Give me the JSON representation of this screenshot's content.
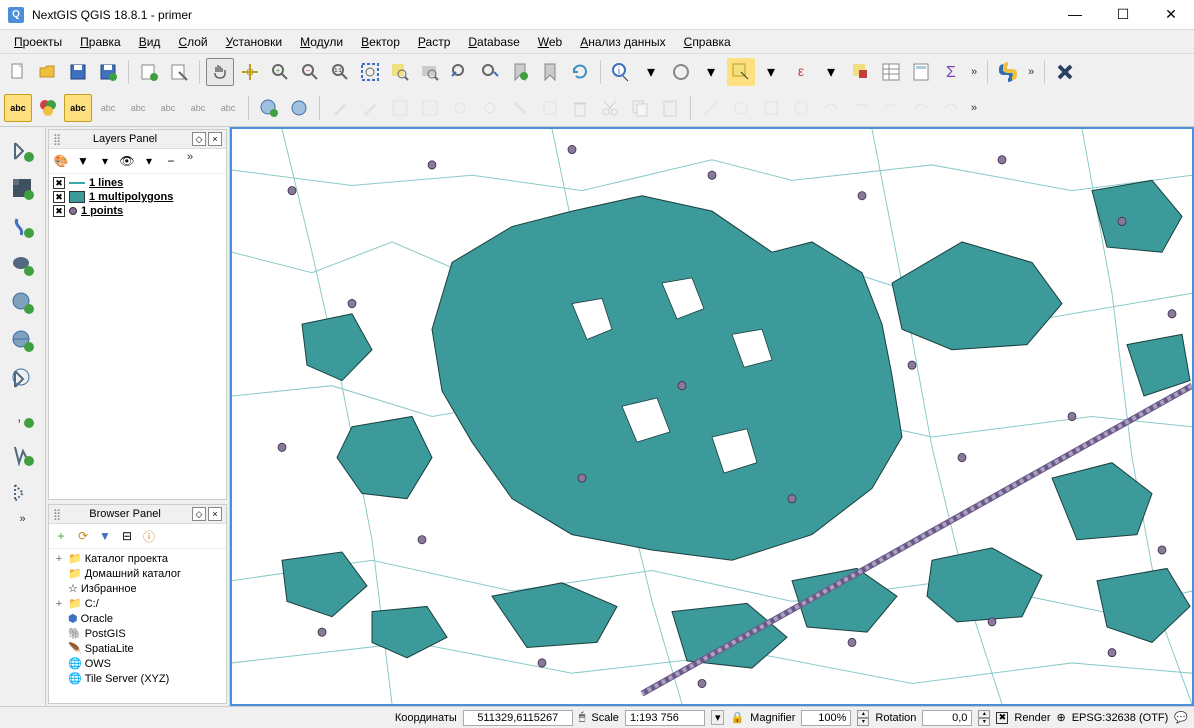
{
  "window": {
    "title": "NextGIS QGIS 18.8.1 - primer",
    "minimize": "—",
    "maximize": "☐",
    "close": "✕"
  },
  "menu": {
    "items": [
      {
        "label": "Проекты",
        "u": "П"
      },
      {
        "label": "Правка",
        "u": "П"
      },
      {
        "label": "Вид",
        "u": "В"
      },
      {
        "label": "Слой",
        "u": "С"
      },
      {
        "label": "Установки",
        "u": "У"
      },
      {
        "label": "Модули",
        "u": "М"
      },
      {
        "label": "Вектор",
        "u": "В"
      },
      {
        "label": "Растр",
        "u": "Р"
      },
      {
        "label": "Database",
        "u": "D"
      },
      {
        "label": "Web",
        "u": "W"
      },
      {
        "label": "Анализ данных",
        "u": "А"
      },
      {
        "label": "Справка",
        "u": "С"
      }
    ]
  },
  "layers_panel": {
    "title": "Layers Panel",
    "items": [
      {
        "name": "1 lines",
        "symbol": "line"
      },
      {
        "name": "1 multipolygons",
        "symbol": "poly"
      },
      {
        "name": "1 points",
        "symbol": "dot"
      }
    ]
  },
  "browser_panel": {
    "title": "Browser Panel",
    "items": [
      {
        "exp": "+",
        "icon": "folder",
        "label": "Каталог проекта"
      },
      {
        "exp": "",
        "icon": "folder",
        "label": "Домашний каталог"
      },
      {
        "exp": "",
        "icon": "star",
        "label": "Избранное"
      },
      {
        "exp": "+",
        "icon": "folder",
        "label": "C:/"
      },
      {
        "exp": "",
        "icon": "db",
        "label": "Oracle"
      },
      {
        "exp": "",
        "icon": "db",
        "label": "PostGIS"
      },
      {
        "exp": "",
        "icon": "db",
        "label": "SpatiaLite"
      },
      {
        "exp": "",
        "icon": "globe",
        "label": "OWS"
      },
      {
        "exp": "",
        "icon": "globe",
        "label": "Tile Server (XYZ)"
      }
    ]
  },
  "status": {
    "coords_label": "Координаты",
    "coords_value": "511329,6115267",
    "scale_label": "Scale",
    "scale_value": "1:193 756",
    "magnifier_label": "Magnifier",
    "magnifier_value": "100%",
    "rotation_label": "Rotation",
    "rotation_value": "0,0",
    "render_label": "Render",
    "epsg": "EPSG:32638 (OTF)"
  },
  "colors": {
    "polygon_fill": "#3d9a9a",
    "polygon_stroke": "#1a4040",
    "line": "#7fc4c4",
    "point_fill": "#8a7a9a"
  }
}
